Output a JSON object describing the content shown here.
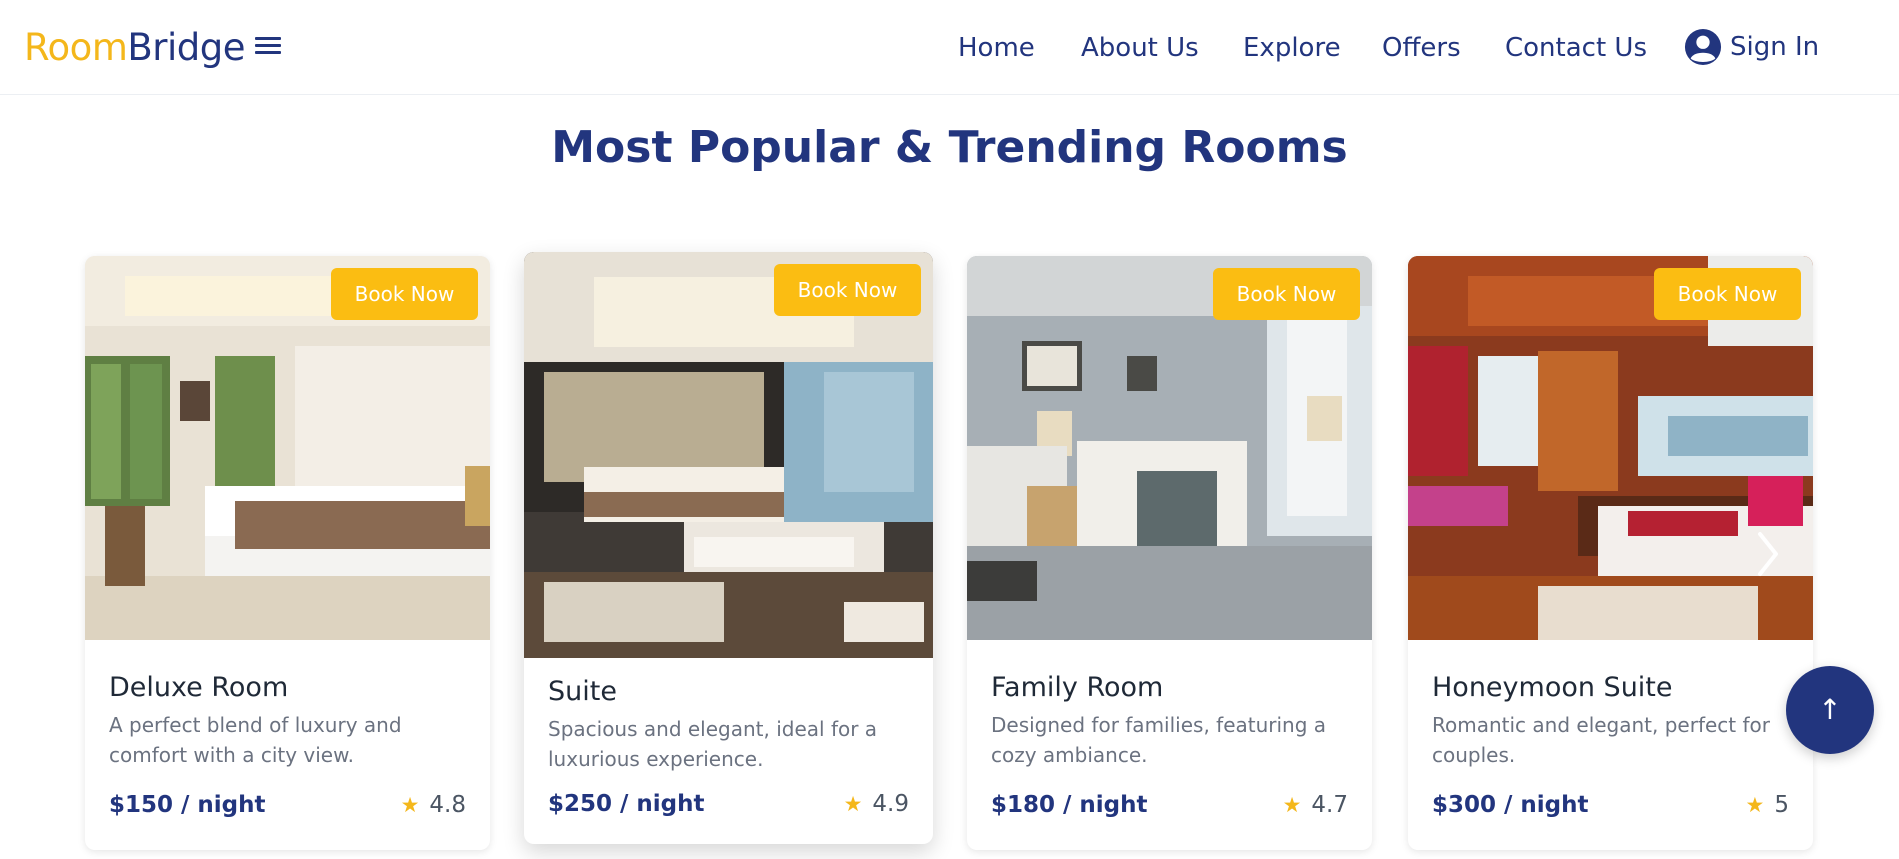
{
  "brand": {
    "part1": "Room",
    "part2": "Bridge"
  },
  "nav": {
    "links": [
      {
        "label": "Home"
      },
      {
        "label": "About Us"
      },
      {
        "label": "Explore"
      },
      {
        "label": "Offers"
      },
      {
        "label": "Contact Us"
      }
    ],
    "sign_in": "Sign In"
  },
  "section": {
    "title": "Most Popular & Trending Rooms"
  },
  "rooms": [
    {
      "name": "Deluxe Room",
      "description": "A perfect blend of luxury and comfort with a city view.",
      "price": "$150 / night",
      "rating": "4.8",
      "book_label": "Book Now"
    },
    {
      "name": "Suite",
      "description": "Spacious and elegant, ideal for a luxurious experience.",
      "price": "$250 / night",
      "rating": "4.9",
      "book_label": "Book Now"
    },
    {
      "name": "Family Room",
      "description": "Designed for families, featuring a cozy ambiance.",
      "price": "$180 / night",
      "rating": "4.7",
      "book_label": "Book Now"
    },
    {
      "name": "Honeymoon Suite",
      "description": "Romantic and elegant, perfect for couples.",
      "price": "$300 / night",
      "rating": "5",
      "book_label": "Book Now"
    }
  ],
  "icons": {
    "menu": "hamburger-menu-icon",
    "user": "user-circle-icon",
    "star": "star-icon",
    "next": "chevron-right-icon",
    "scroll_top": "arrow-up-icon"
  },
  "scroll_top_symbol": "↑",
  "colors": {
    "brand_yellow": "#f4b71b",
    "brand_navy": "#22357e",
    "button_yellow": "#fbbd12",
    "text_muted": "#6b7280"
  }
}
